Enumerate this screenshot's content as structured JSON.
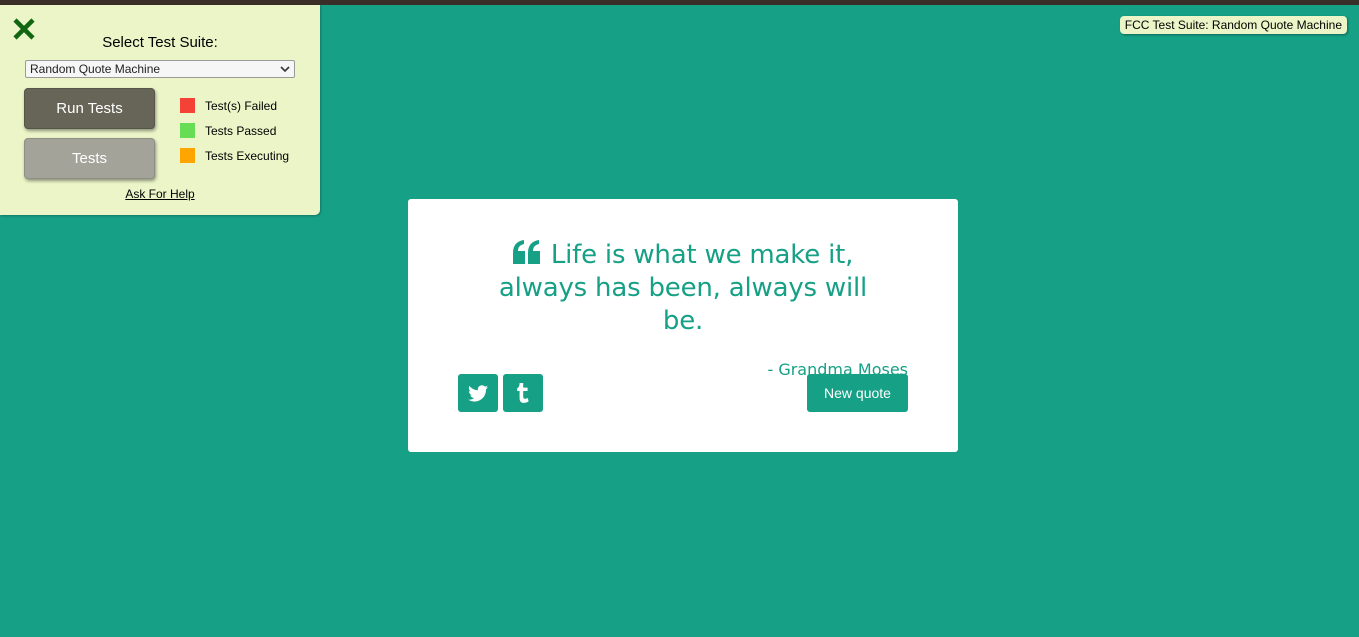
{
  "colors": {
    "background": "#16a085",
    "accent": "#16a085",
    "panel": "#ebf5c8",
    "failed": "#f44336",
    "passed": "#66dd55",
    "executing": "#ffa500"
  },
  "fcc_panel": {
    "close_icon": "close-icon",
    "select_label": "Select Test Suite:",
    "selected_suite": "Random Quote Machine",
    "run_tests_label": "Run Tests",
    "tests_label": "Tests",
    "legend": [
      {
        "label": "Test(s) Failed",
        "color": "#f44336"
      },
      {
        "label": "Tests Passed",
        "color": "#66dd55"
      },
      {
        "label": "Tests Executing",
        "color": "#ffa500"
      }
    ],
    "help_label": "Ask For Help"
  },
  "badge": {
    "text": "FCC Test Suite: Random Quote Machine"
  },
  "quote": {
    "icon": "quote-left-icon",
    "text": "Life is what we make it, always has been, always will be.",
    "author": "- Grandma Moses",
    "tweet_icon": "twitter-icon",
    "tumblr_icon": "tumblr-icon",
    "new_quote_label": "New quote"
  }
}
